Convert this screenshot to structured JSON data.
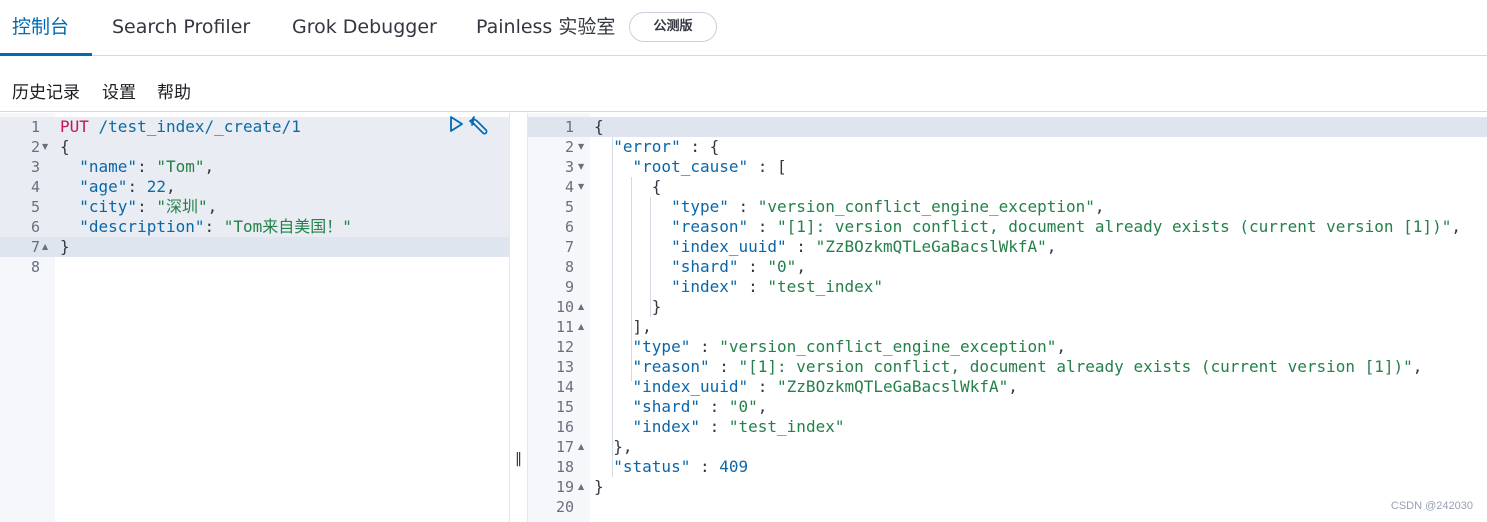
{
  "tabs": {
    "console": "控制台",
    "search_profiler": "Search Profiler",
    "grok_debugger": "Grok Debugger",
    "painless": "Painless 实验室",
    "beta": "公测版"
  },
  "submenu": {
    "history": "历史记录",
    "settings": "设置",
    "help": "帮助"
  },
  "request": {
    "method": "PUT",
    "path": " /test_index/_create/1",
    "lines": [
      {
        "n": "1",
        "text": ""
      },
      {
        "n": "2",
        "text": "{"
      },
      {
        "n": "3",
        "text": "  \"name\": \"Tom\","
      },
      {
        "n": "4",
        "text": "  \"age\": 22,"
      },
      {
        "n": "5",
        "text": "  \"city\": \"深圳\","
      },
      {
        "n": "6",
        "text": "  \"description\": \"Tom来自美国！\""
      },
      {
        "n": "7",
        "text": "}"
      },
      {
        "n": "8",
        "text": ""
      }
    ]
  },
  "response": {
    "lines": [
      {
        "n": "1",
        "text": "{"
      },
      {
        "n": "2",
        "text": "  \"error\" : {"
      },
      {
        "n": "3",
        "text": "    \"root_cause\" : ["
      },
      {
        "n": "4",
        "text": "      {"
      },
      {
        "n": "5",
        "text": "        \"type\" : \"version_conflict_engine_exception\","
      },
      {
        "n": "6",
        "text": "        \"reason\" : \"[1]: version conflict, document already exists (current version [1])\","
      },
      {
        "n": "7",
        "text": "        \"index_uuid\" : \"ZzBOzkmQTLeGaBacslWkfA\","
      },
      {
        "n": "8",
        "text": "        \"shard\" : \"0\","
      },
      {
        "n": "9",
        "text": "        \"index\" : \"test_index\""
      },
      {
        "n": "10",
        "text": "      }"
      },
      {
        "n": "11",
        "text": "    ],"
      },
      {
        "n": "12",
        "text": "    \"type\" : \"version_conflict_engine_exception\","
      },
      {
        "n": "13",
        "text": "    \"reason\" : \"[1]: version conflict, document already exists (current version [1])\","
      },
      {
        "n": "14",
        "text": "    \"index_uuid\" : \"ZzBOzkmQTLeGaBacslWkfA\","
      },
      {
        "n": "15",
        "text": "    \"shard\" : \"0\","
      },
      {
        "n": "16",
        "text": "    \"index\" : \"test_index\""
      },
      {
        "n": "17",
        "text": "  },"
      },
      {
        "n": "18",
        "text": "  \"status\" : 409"
      },
      {
        "n": "19",
        "text": "}"
      },
      {
        "n": "20",
        "text": ""
      }
    ]
  },
  "watermark": "CSDN @242030",
  "colors": {
    "accent": "#006bb4",
    "string": "#25804a",
    "method": "#c41656",
    "gutter": "#f5f7fa"
  }
}
